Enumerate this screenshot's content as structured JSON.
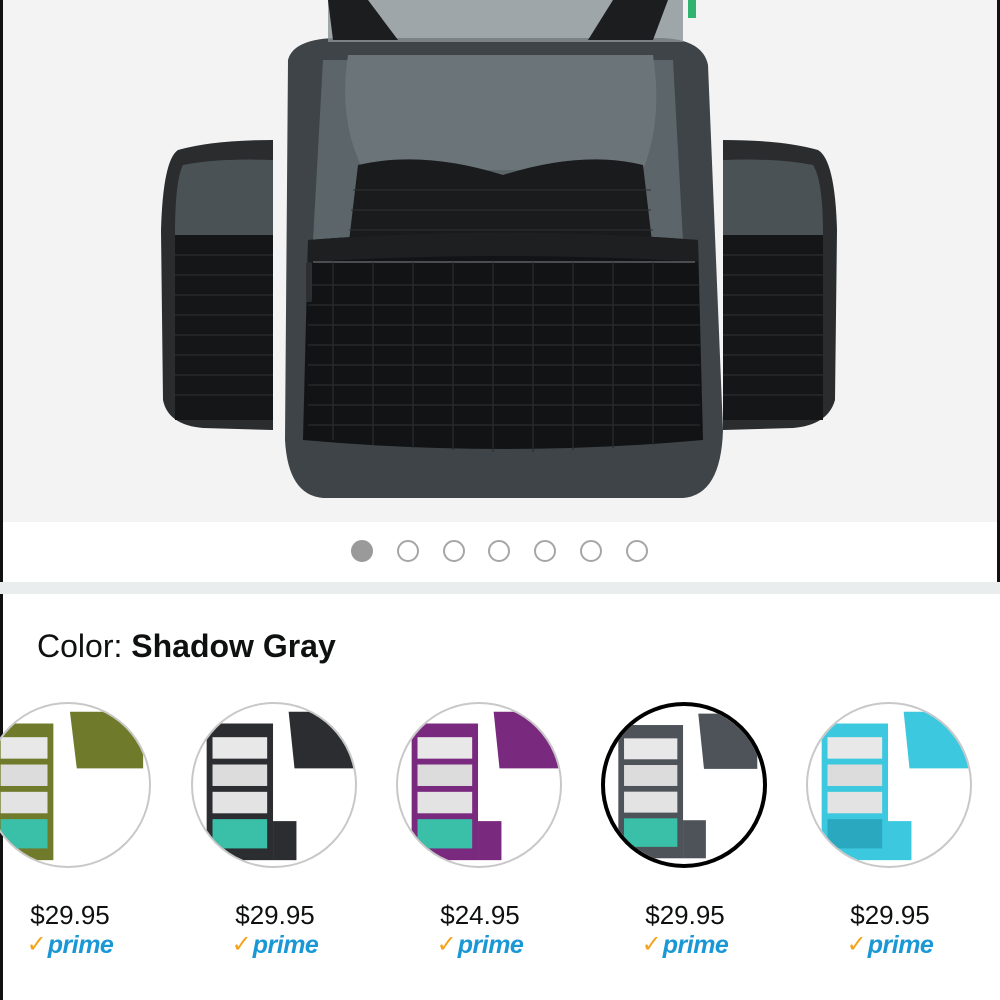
{
  "gallery": {
    "dot_count": 7,
    "active_index": 0
  },
  "variation": {
    "color_prefix": "Color: ",
    "selected_color": "Shadow Gray"
  },
  "swatches": [
    {
      "color": "#6f7a2a",
      "price": "$29.95",
      "prime": "prime",
      "selected": false
    },
    {
      "color": "#2b2d30",
      "price": "$29.95",
      "prime": "prime",
      "selected": false
    },
    {
      "color": "#7a2a7e",
      "price": "$24.95",
      "prime": "prime",
      "selected": false
    },
    {
      "color": "#4d5358",
      "price": "$29.95",
      "prime": "prime",
      "selected": true
    },
    {
      "color": "#3cc8de",
      "price": "$29.95",
      "prime": "prime",
      "selected": false
    }
  ],
  "colors": {
    "prime_check": "#f4a41c",
    "prime_text": "#1a98d5",
    "dot_active": "#9a9a9a"
  }
}
